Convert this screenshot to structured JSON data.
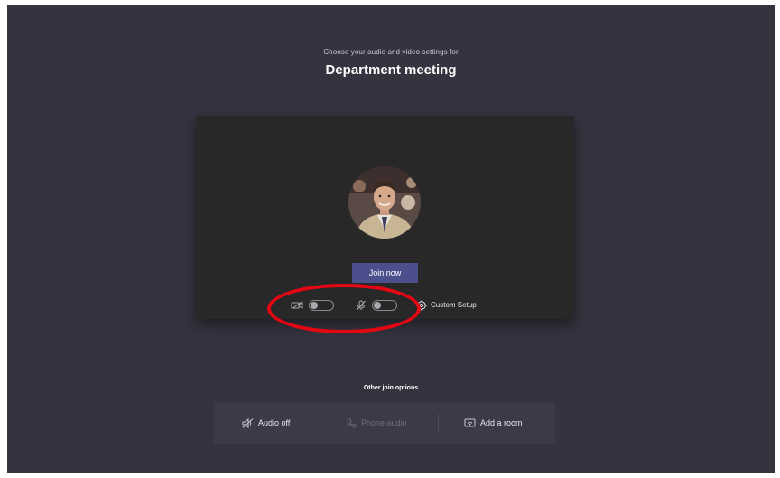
{
  "header": {
    "subtitle": "Choose your audio and video settings for",
    "meeting_title": "Department meeting"
  },
  "preview": {
    "join_button_label": "Join now",
    "camera_toggle": {
      "icon": "camera-off-icon",
      "state": "off"
    },
    "mic_toggle": {
      "icon": "mic-off-icon",
      "state": "off"
    },
    "custom_setup": {
      "icon": "gear-icon",
      "label": "Custom Setup"
    }
  },
  "other_options": {
    "heading": "Other join options",
    "items": [
      {
        "icon": "speaker-off-icon",
        "label": "Audio off",
        "enabled": true
      },
      {
        "icon": "phone-icon",
        "label": "Phone audio",
        "enabled": false
      },
      {
        "icon": "cast-screen-icon",
        "label": "Add a room",
        "enabled": true
      }
    ]
  },
  "colors": {
    "background": "#34333f",
    "preview_bg": "#292828",
    "primary_button": "#4b4f8c",
    "annotation_circle": "#e30613"
  }
}
